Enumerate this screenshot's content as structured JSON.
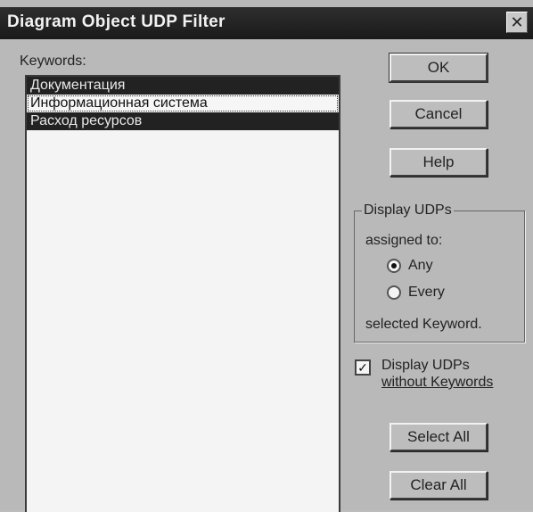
{
  "window": {
    "title": "Diagram Object UDP Filter",
    "close_glyph": "✕"
  },
  "keywords": {
    "label": "Keywords:",
    "items": [
      {
        "label": "Документация",
        "state": "selected"
      },
      {
        "label": "Информационная система",
        "state": "focused"
      },
      {
        "label": "Расход ресурсов",
        "state": "selected"
      }
    ]
  },
  "buttons": {
    "ok": "OK",
    "cancel": "Cancel",
    "help": "Help",
    "select_all": "Select All",
    "clear_all": "Clear All"
  },
  "display_group": {
    "legend": "Display UDPs",
    "sub": "assigned to:",
    "options": [
      {
        "label": "Any",
        "selected": true
      },
      {
        "label": "Every",
        "selected": false
      }
    ],
    "footer": "selected Keyword."
  },
  "checkbox": {
    "line1": "Display UDPs",
    "line2": "without Keywords",
    "checked": true,
    "check_glyph": "✓"
  }
}
